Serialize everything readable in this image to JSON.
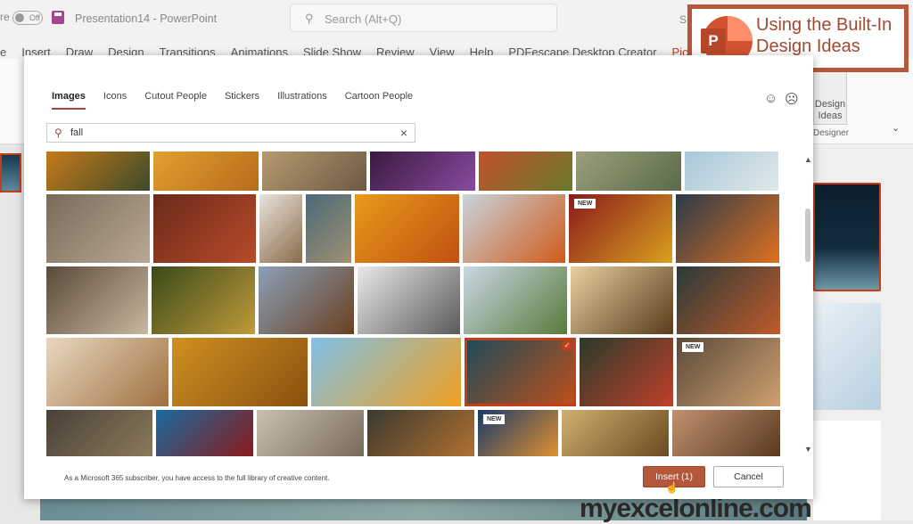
{
  "titlebar": {
    "autosave_prefix": "re",
    "toggle": "Off",
    "doc_title": "Presentation14  -  PowerPoint",
    "search_placeholder": "Search (Alt+Q)",
    "user": "S Smith"
  },
  "menu": [
    "e",
    "Insert",
    "Draw",
    "Design",
    "Transitions",
    "Animations",
    "Slide Show",
    "Review",
    "View",
    "Help",
    "PDFescape Desktop Creator",
    "Picture Form"
  ],
  "ribbon": {
    "design_ideas": "Design Ideas",
    "group": "Designer"
  },
  "overlay": {
    "title": "Using the Built-In Design Ideas",
    "logo_letter": "P"
  },
  "watermark": "myexcelonline.com",
  "dialog": {
    "tabs": [
      {
        "label": "Images",
        "active": true
      },
      {
        "label": "Icons"
      },
      {
        "label": "Cutout People"
      },
      {
        "label": "Stickers"
      },
      {
        "label": "Illustrations"
      },
      {
        "label": "Cartoon People"
      }
    ],
    "feedback": {
      "smile": "☺",
      "frown": "☹"
    },
    "search": {
      "value": "fall",
      "clear": "×"
    },
    "rows": [
      [
        {
          "c": [
            "#c57a1a",
            "#3d4b2a"
          ]
        },
        {
          "c": [
            "#e0a030",
            "#b86b1a"
          ]
        },
        {
          "c": [
            "#b79a70",
            "#6b5a44"
          ]
        },
        {
          "c": [
            "#3a1a40",
            "#8a4aa0"
          ]
        },
        {
          "c": [
            "#c0502a",
            "#6a7a2a"
          ]
        },
        {
          "c": [
            "#9aa07a",
            "#5a6a4a"
          ]
        },
        {
          "c": [
            "#a8c8d8",
            "#e0e8ea"
          ]
        }
      ],
      [
        {
          "c": [
            "#7a6a5a",
            "#b8a894"
          ]
        },
        {
          "c": [
            "#6a2a1a",
            "#b84a2a"
          ]
        },
        {
          "c": [
            "#e8e4dc",
            "#8a6a4a"
          ]
        },
        {
          "c": [
            "#4a6a7a",
            "#a09070"
          ]
        },
        {
          "c": [
            "#e89a1a",
            "#c05010"
          ]
        },
        {
          "c": [
            "#c8d4dc",
            "#d05a1a"
          ]
        },
        {
          "c": [
            "#8a1a1a",
            "#d8a020"
          ],
          "badge": "NEW"
        },
        {
          "c": [
            "#2a3a4a",
            "#e07020"
          ]
        }
      ],
      [
        {
          "c": [
            "#5a4a3a",
            "#c8b8a0"
          ]
        },
        {
          "c": [
            "#3a4a1a",
            "#c09a3a"
          ]
        },
        {
          "c": [
            "#8aa0b8",
            "#6a4020"
          ]
        },
        {
          "c": [
            "#e8eaea",
            "#5a5a5a"
          ]
        },
        {
          "c": [
            "#c8d8e4",
            "#5a7a3a"
          ]
        },
        {
          "c": [
            "#e8d0a0",
            "#5a3a1a"
          ]
        },
        {
          "c": [
            "#2a3a3a",
            "#c05a2a"
          ]
        }
      ],
      [
        {
          "c": [
            "#e8d8c0",
            "#a07040"
          ]
        },
        {
          "c": [
            "#d09020",
            "#8a5010"
          ]
        },
        {
          "c": [
            "#80c0e8",
            "#f0a020"
          ]
        },
        {
          "c": [
            "#1a4a5a",
            "#c0501a"
          ],
          "selected": true,
          "check": "✓"
        },
        {
          "c": [
            "#2a3a2a",
            "#c0402a"
          ]
        },
        {
          "c": [
            "#5a4a3a",
            "#d0a070"
          ],
          "badge": "NEW"
        }
      ],
      [
        {
          "c": [
            "#4a4038",
            "#8a7a5a"
          ]
        },
        {
          "c": [
            "#1a6aa0",
            "#8a1a1a"
          ]
        },
        {
          "c": [
            "#c8c0b0",
            "#7a6a5a"
          ]
        },
        {
          "c": [
            "#3a3a30",
            "#b07030"
          ]
        },
        {
          "c": [
            "#1a3a6a",
            "#e09030"
          ],
          "badge": "NEW"
        },
        {
          "c": [
            "#d0b070",
            "#6a4a20"
          ]
        },
        {
          "c": [
            "#c09070",
            "#5a3a20"
          ]
        }
      ]
    ],
    "footer_text": "As a Microsoft 365 subscriber, you have access to the full library of creative content.",
    "insert_label": "Insert (1)",
    "cancel_label": "Cancel"
  },
  "colors": {
    "accent": "#b5573a",
    "selection": "#c43e1c"
  }
}
